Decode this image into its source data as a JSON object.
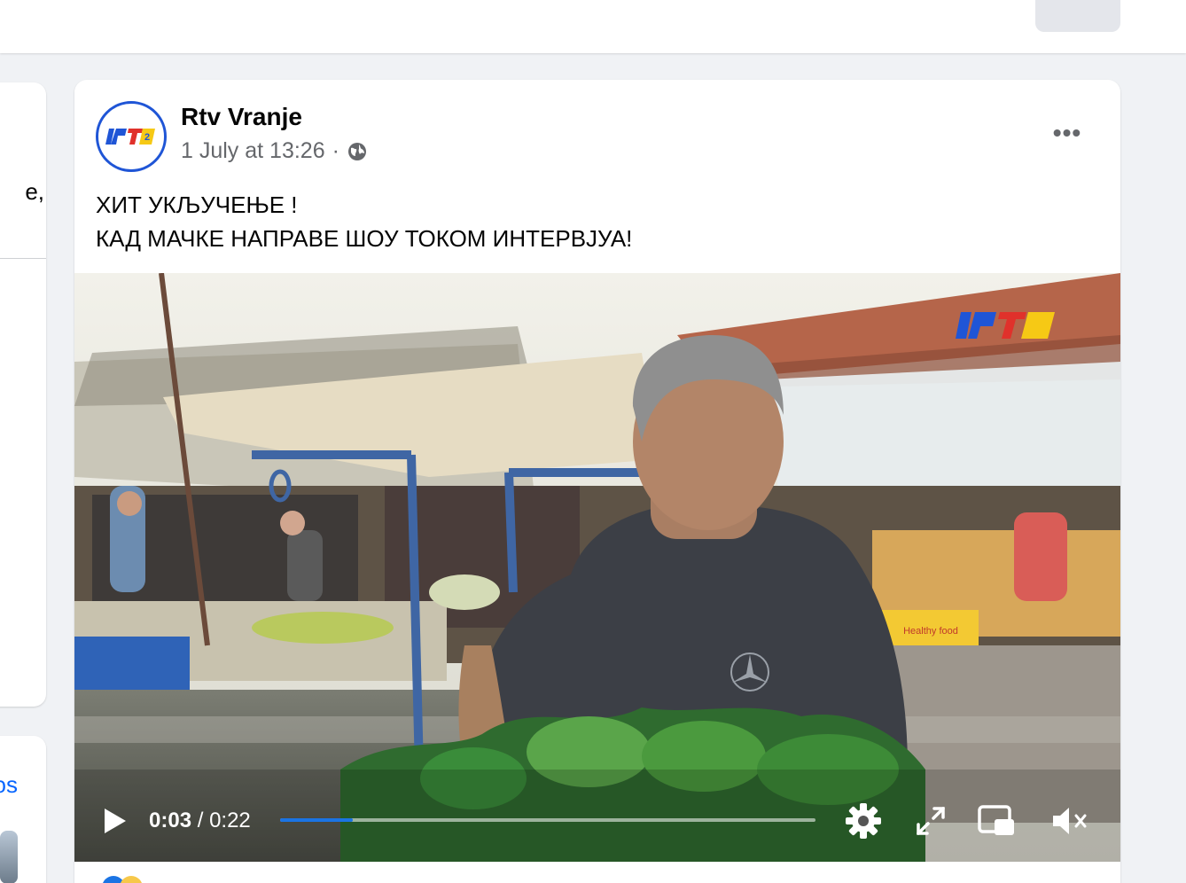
{
  "topbar": {
    "more_label": "•••"
  },
  "left_sidebar": {
    "fragment_text": "e,",
    "fragment_link": "os"
  },
  "post": {
    "author": "Rtv Vranje",
    "timestamp": "1 July at 13:26",
    "separator": "·",
    "audience_icon": "globe-icon",
    "more_label": "•••",
    "text_lines": [
      "ХИТ УКЉУЧЕЊЕ !",
      "КАД МАЧКЕ НАПРАВЕ ШОУ ТОКОМ ИНТЕРВЈУА!"
    ],
    "logo_text": "IPTV"
  },
  "video": {
    "current_time": "0:03",
    "time_separator": "/",
    "duration": "0:22",
    "progress_fraction": 0.136,
    "controls": [
      "play-icon",
      "settings-icon",
      "fullscreen-icon",
      "picture-in-picture-icon",
      "muted-icon"
    ],
    "box_text": "Healthy food"
  },
  "colors": {
    "accent": "#1b74e4",
    "avatar_ring": "#1f55d6",
    "secondary_text": "#65676b"
  }
}
